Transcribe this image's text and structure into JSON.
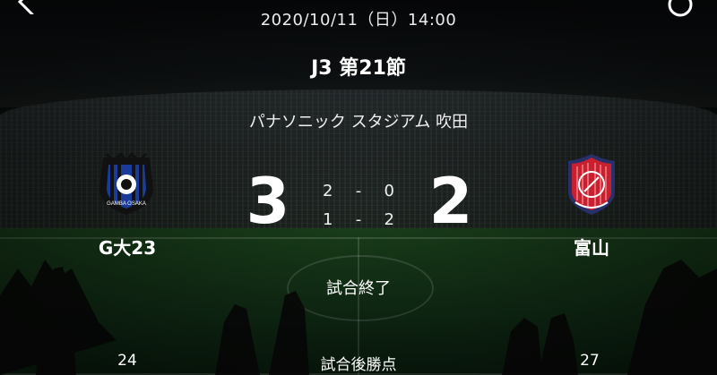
{
  "match": {
    "datetime": "2020/10/11（日）14:00",
    "league": "J3 第21節",
    "stadium": "パナソニック スタジアム 吹田",
    "home": {
      "name": "G大23",
      "score": "3",
      "first_half": "2",
      "second_half": "1",
      "points": "24",
      "crest": "gamba-osaka-crest",
      "crest_text": "GAMBA OSAKA"
    },
    "away": {
      "name": "富山",
      "score": "2",
      "first_half": "0",
      "second_half": "2",
      "points": "27",
      "crest": "kataller-toyama-crest"
    },
    "half_separator": "-",
    "status": "試合終了",
    "points_label": "試合後勝点"
  },
  "colors": {
    "gamba_blue": "#1a3b9a",
    "gamba_black": "#111111",
    "toyama_red": "#c8202e",
    "toyama_navy": "#27306b"
  }
}
